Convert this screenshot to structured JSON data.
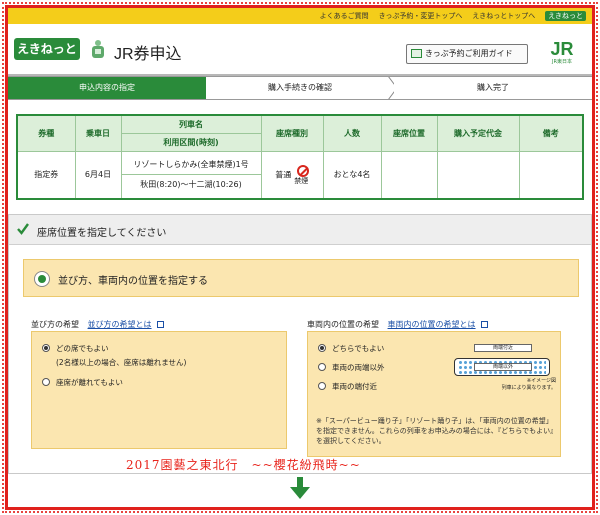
{
  "topbar": {
    "links": [
      "よくあるご質問",
      "きっぷ予約・変更トップへ",
      "えきねっとトップへ"
    ],
    "badge": "えきねっと"
  },
  "header": {
    "logo": "えきねっと",
    "title": "JR券申込",
    "guide_button": "きっぷ予約ご利用ガイド",
    "jr_mark": "JR",
    "jr_sub": "JR東日本"
  },
  "steps": [
    {
      "label": "申込内容の指定",
      "active": true
    },
    {
      "label": "購入手続きの確認",
      "active": false
    },
    {
      "label": "購入完了",
      "active": false
    }
  ],
  "table": {
    "headers": {
      "ticket": "券種",
      "date": "乗車日",
      "train_name": "列車名",
      "segment": "利用区間(時刻)",
      "seat_type": "座席種別",
      "people": "人数",
      "seat_pos": "座席位置",
      "price": "購入予定代金",
      "notes": "備考"
    },
    "row": {
      "ticket": "指定券",
      "date": "6月4日",
      "train_name": "リゾートしらかみ(全車禁煙)1号",
      "segment": "秋田(8:20)～十二湖(10:26)",
      "seat_type": "普通",
      "smoke": "禁煙",
      "people": "おとな4名",
      "seat_pos": "",
      "price": "",
      "notes": ""
    }
  },
  "seat_section": {
    "title": "座席位置を指定してください",
    "main_option": "並び方、車両内の位置を指定する",
    "left": {
      "title": "並び方の希望",
      "help": "並び方の希望とは",
      "options": [
        {
          "label": "どの席でもよい",
          "selected": true
        },
        {
          "label": "(2名様以上の場合、座席は離れません)",
          "selected": false
        },
        {
          "label": "座席が離れてもよい",
          "selected": false
        }
      ]
    },
    "right": {
      "title": "車両内の位置の希望",
      "help": "車両内の位置の希望とは",
      "options": [
        {
          "label": "どちらでもよい",
          "selected": true
        },
        {
          "label": "車両の両端以外",
          "selected": false
        },
        {
          "label": "車両の端付近",
          "selected": false
        }
      ],
      "diagram_top": "両端付近",
      "diagram_mid": "両端以外",
      "diagram_note1": "※イメージ図",
      "diagram_note2": "列車により異なります。",
      "note": "※「スーパービュー踊り子」「リゾート踊り子」は、「車両内の位置の希望」を指定できません。これらの列車をお申込みの場合には、『どちらでもよい』を選択してください。"
    }
  },
  "caption": "2017園藝之東北行　~~櫻花紛飛時~~",
  "colors": {
    "brand_green": "#2a8b3a",
    "topbar_yellow": "#f4cd1a",
    "option_bg": "#fbe6b0",
    "frame_red": "#e0211d"
  }
}
